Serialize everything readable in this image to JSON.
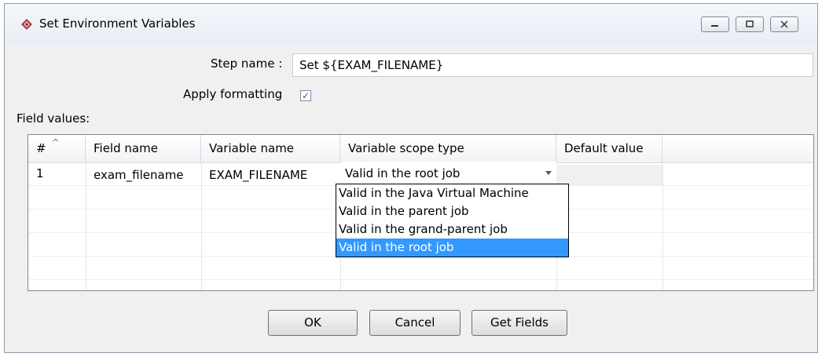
{
  "window": {
    "title": "Set Environment Variables",
    "controls": {
      "minimize": "▭",
      "maximize": "▣",
      "close": "✕"
    }
  },
  "form": {
    "step_name_label": "Step name :",
    "step_name_value": "Set ${EXAM_FILENAME}",
    "apply_formatting_label": "Apply formatting",
    "apply_formatting_checked": true,
    "checkbox_glyph": "✓",
    "field_values_label": "Field values:"
  },
  "table": {
    "sort_glyph": "^",
    "columns": [
      "#",
      "Field name",
      "Variable name",
      "Variable scope type",
      "Default value"
    ],
    "rows": [
      {
        "num": "1",
        "field_name": "exam_filename",
        "variable_name": "EXAM_FILENAME",
        "scope": "Valid in the root job",
        "default": ""
      }
    ]
  },
  "dropdown": {
    "options": [
      "Valid in the Java Virtual Machine",
      "Valid in the parent job",
      "Valid in the grand-parent job",
      "Valid in the root job"
    ],
    "selected_index": 3
  },
  "buttons": {
    "ok": "OK",
    "cancel": "Cancel",
    "get_fields": "Get Fields"
  },
  "colors": {
    "selection": "#3399ff",
    "checkbox_check": "#2a5aa8"
  }
}
